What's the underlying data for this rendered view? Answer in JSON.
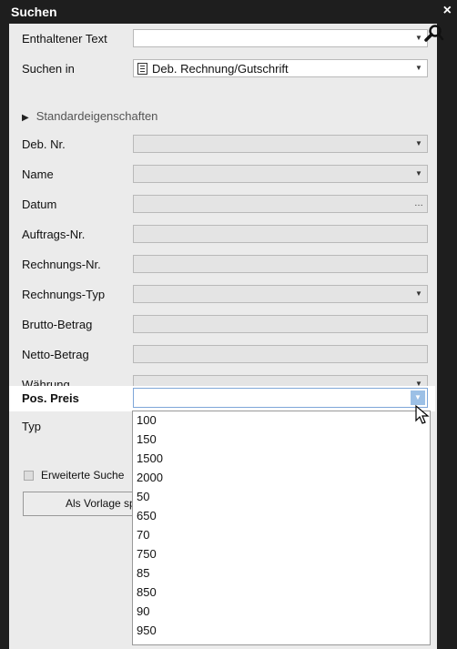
{
  "window": {
    "title": "Suchen",
    "close": "×"
  },
  "form": {
    "contained_text": {
      "label": "Enthaltener Text",
      "value": ""
    },
    "search_in": {
      "label": "Suchen in",
      "value": "Deb. Rechnung/Gutschrift"
    },
    "section_standard": "Standardeigenschaften",
    "fields": [
      {
        "label": "Deb. Nr.",
        "control": "dropdown"
      },
      {
        "label": "Name",
        "control": "dropdown"
      },
      {
        "label": "Datum",
        "control": "picker"
      },
      {
        "label": "Auftrags-Nr.",
        "control": "text"
      },
      {
        "label": "Rechnungs-Nr.",
        "control": "text"
      },
      {
        "label": "Rechnungs-Typ",
        "control": "dropdown"
      },
      {
        "label": "Brutto-Betrag",
        "control": "text"
      },
      {
        "label": "Netto-Betrag",
        "control": "text"
      },
      {
        "label": "Währung",
        "control": "dropdown"
      }
    ],
    "pos_preis": {
      "label": "Pos. Preis",
      "value": ""
    },
    "typ_label": "Typ",
    "extended_search": {
      "label": "Erweiterte Suche",
      "checked": false
    },
    "save_template_button": "Als Vorlage spei"
  },
  "dropdown_options": [
    "100",
    "150",
    "1500",
    "2000",
    "50",
    "650",
    "70",
    "750",
    "85",
    "850",
    "90",
    "950"
  ]
}
